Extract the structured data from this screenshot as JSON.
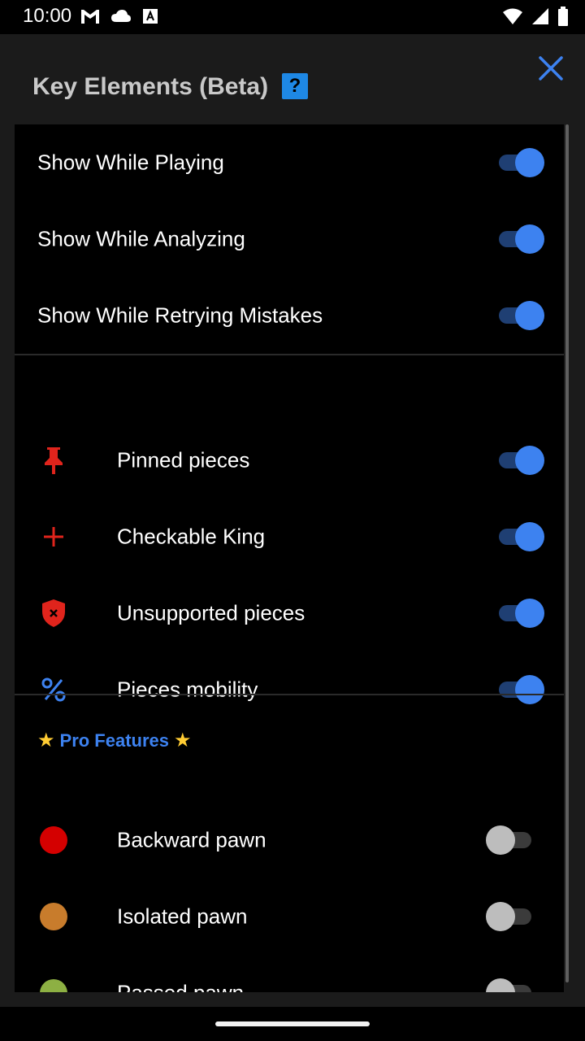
{
  "status_bar": {
    "time": "10:00",
    "left_icons": [
      "gmail-icon",
      "cloud-icon",
      "font-badge-icon"
    ],
    "right_icons": [
      "wifi-icon",
      "cell-signal-icon",
      "battery-icon"
    ]
  },
  "dialog": {
    "title": "Key Elements (Beta)",
    "help_label": "?",
    "close_icon": "close-icon",
    "accent_color": "#3d82f0"
  },
  "general_settings": [
    {
      "label": "Show While Playing",
      "enabled": true
    },
    {
      "label": "Show While Analyzing",
      "enabled": true
    },
    {
      "label": "Show While Retrying Mistakes",
      "enabled": true
    }
  ],
  "elements": [
    {
      "label": "Pinned pieces",
      "icon": "pushpin-icon",
      "icon_color": "#e0241c",
      "enabled": true
    },
    {
      "label": "Checkable King",
      "icon": "plus-icon",
      "icon_color": "#e0241c",
      "enabled": true
    },
    {
      "label": "Unsupported pieces",
      "icon": "shield-x-icon",
      "icon_color": "#e0241c",
      "enabled": true
    },
    {
      "label": "Pieces mobility",
      "icon": "percent-icon",
      "icon_color": "#3d82f0",
      "enabled": true
    }
  ],
  "pro_features": {
    "header": "Pro Features",
    "header_icon": "star-icon",
    "items": [
      {
        "label": "Backward pawn",
        "color": "#d40000",
        "enabled": false
      },
      {
        "label": "Isolated pawn",
        "color": "#c87c2c",
        "enabled": false
      },
      {
        "label": "Passed pawn",
        "color": "#8db043",
        "enabled": false
      }
    ]
  }
}
